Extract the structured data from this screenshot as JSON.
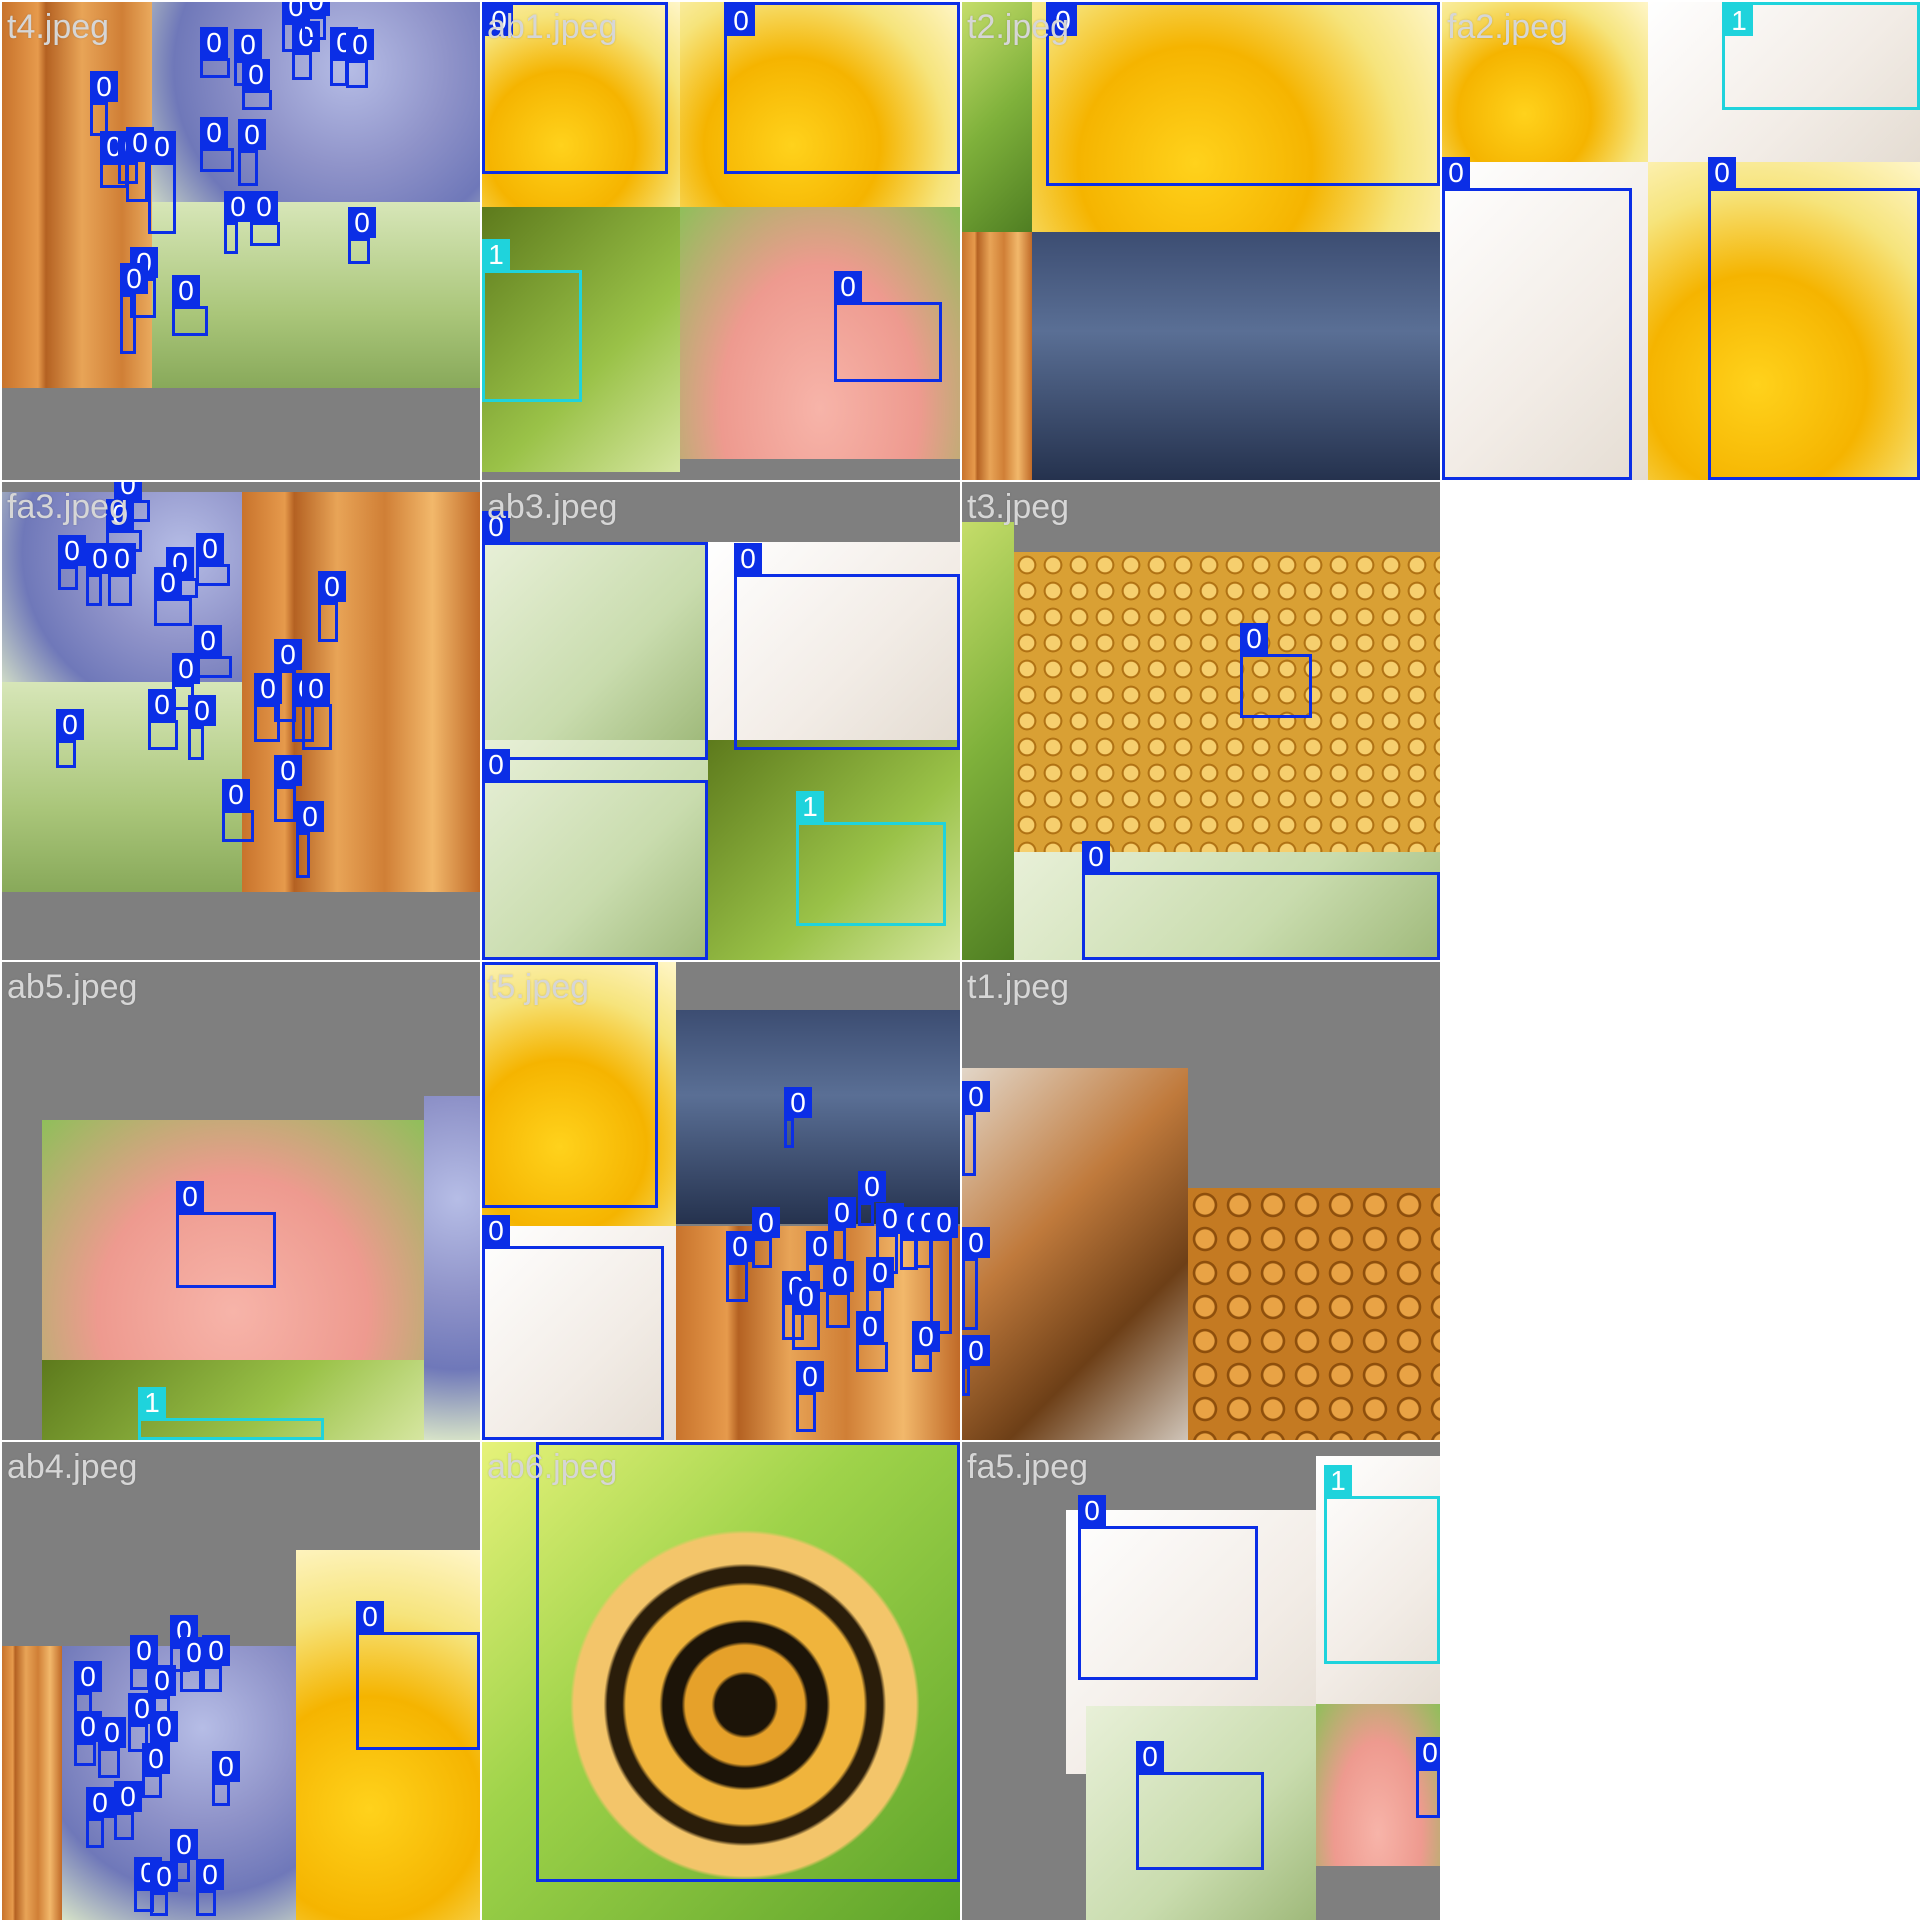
{
  "tiles": [
    {
      "name": "t4.jpeg"
    },
    {
      "name": "ab1.jpeg"
    },
    {
      "name": "t2.jpeg"
    },
    {
      "name": "fa2.jpeg"
    },
    {
      "name": "fa3.jpeg"
    },
    {
      "name": "ab3.jpeg"
    },
    {
      "name": "t3.jpeg"
    },
    {
      "name": "ab5.jpeg"
    },
    {
      "name": "t5.jpeg"
    },
    {
      "name": "t1.jpeg"
    },
    {
      "name": "ab4.jpeg"
    },
    {
      "name": "ab6.jpeg"
    },
    {
      "name": "fa5.jpeg"
    }
  ],
  "class_labels": {
    "c0": "0",
    "c1": "1"
  },
  "colors": {
    "class0": "#0b2ee6",
    "class1": "#1fd3dc",
    "padding_gray": "#7f7f7f",
    "filename_text": "#d6d6d6"
  }
}
